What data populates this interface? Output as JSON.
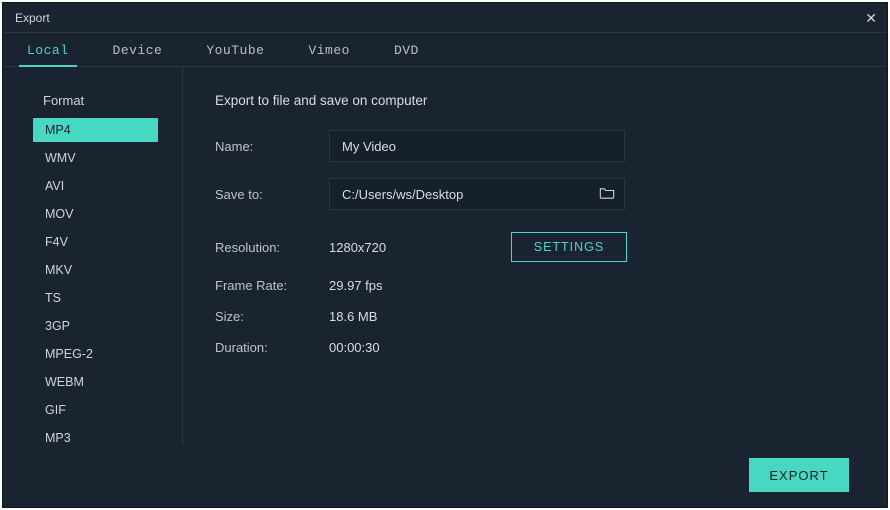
{
  "window": {
    "title": "Export"
  },
  "tabs": [
    {
      "label": "Local",
      "active": true
    },
    {
      "label": "Device",
      "active": false
    },
    {
      "label": "YouTube",
      "active": false
    },
    {
      "label": "Vimeo",
      "active": false
    },
    {
      "label": "DVD",
      "active": false
    }
  ],
  "sidebar": {
    "heading": "Format",
    "items": [
      {
        "label": "MP4",
        "selected": true
      },
      {
        "label": "WMV",
        "selected": false
      },
      {
        "label": "AVI",
        "selected": false
      },
      {
        "label": "MOV",
        "selected": false
      },
      {
        "label": "F4V",
        "selected": false
      },
      {
        "label": "MKV",
        "selected": false
      },
      {
        "label": "TS",
        "selected": false
      },
      {
        "label": "3GP",
        "selected": false
      },
      {
        "label": "MPEG-2",
        "selected": false
      },
      {
        "label": "WEBM",
        "selected": false
      },
      {
        "label": "GIF",
        "selected": false
      },
      {
        "label": "MP3",
        "selected": false
      }
    ]
  },
  "main": {
    "lead": "Export to file and save on computer",
    "name_label": "Name:",
    "name_value": "My Video",
    "saveto_label": "Save to:",
    "saveto_value": "C:/Users/ws/Desktop",
    "resolution_label": "Resolution:",
    "resolution_value": "1280x720",
    "settings_label": "SETTINGS",
    "framerate_label": "Frame Rate:",
    "framerate_value": "29.97 fps",
    "size_label": "Size:",
    "size_value": "18.6 MB",
    "duration_label": "Duration:",
    "duration_value": "00:00:30"
  },
  "footer": {
    "export_label": "EXPORT"
  }
}
